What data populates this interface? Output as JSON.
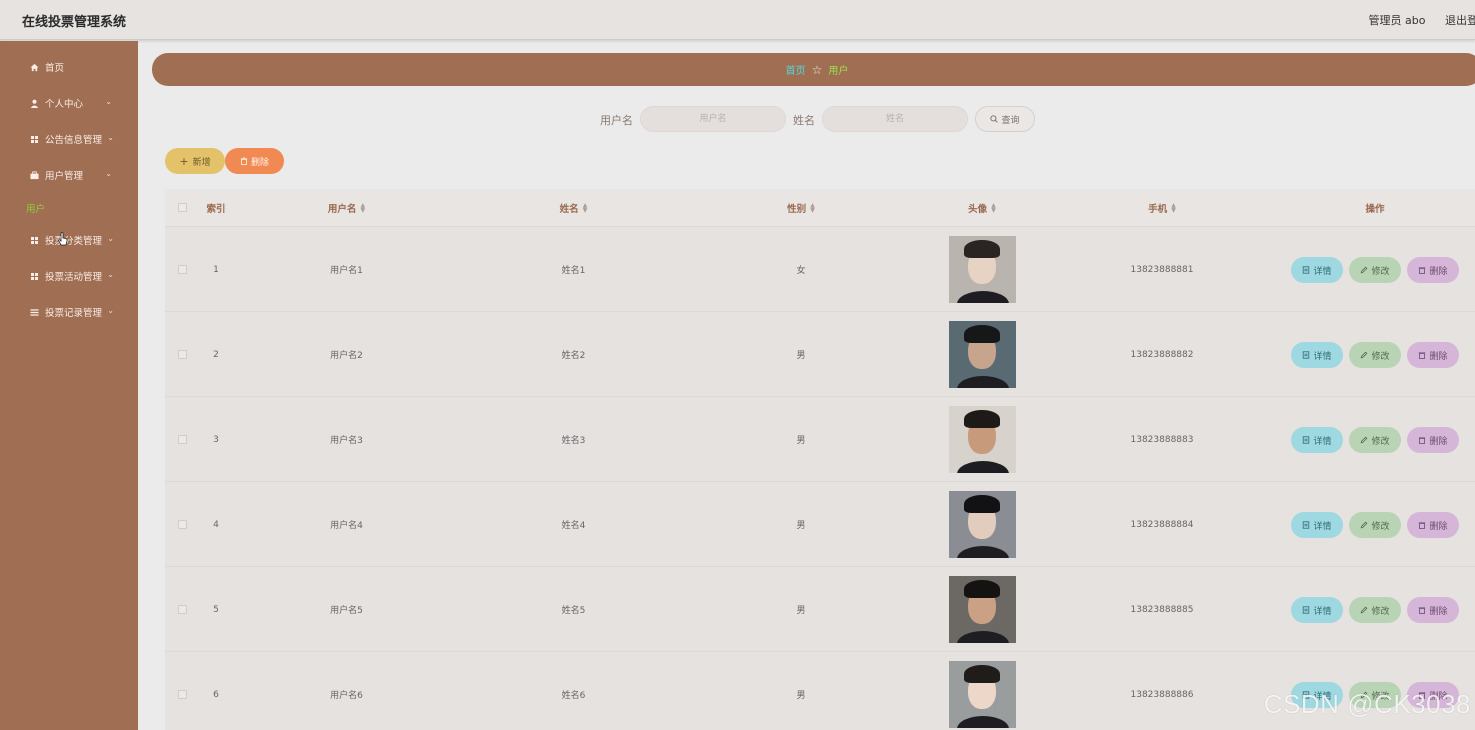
{
  "header": {
    "title": "在线投票管理系统",
    "user": "管理员 abo",
    "logout": "退出登录"
  },
  "sidebar": {
    "items": [
      {
        "label": "首页",
        "icon": "home-icon"
      },
      {
        "label": "个人中心",
        "icon": "user-icon"
      },
      {
        "label": "公告信息管理",
        "icon": "grid-icon"
      },
      {
        "label": "用户管理",
        "icon": "briefcase-icon"
      },
      {
        "label": "投票分类管理",
        "icon": "grid-icon"
      },
      {
        "label": "投票活动管理",
        "icon": "grid-icon"
      },
      {
        "label": "投票记录管理",
        "icon": "list-icon"
      }
    ],
    "active_sub": "用户"
  },
  "breadcrumb": {
    "home": "首页",
    "current": "用户"
  },
  "search": {
    "username_label": "用户名",
    "username_placeholder": "用户名",
    "name_label": "姓名",
    "name_placeholder": "姓名",
    "query_label": "查询"
  },
  "actions": {
    "add_label": "新增",
    "delete_label": "删除"
  },
  "table": {
    "headers": {
      "index": "索引",
      "username": "用户名",
      "name": "姓名",
      "gender": "性别",
      "avatar": "头像",
      "phone": "手机",
      "operation": "操作"
    },
    "row_actions": {
      "detail": "详情",
      "edit": "修改",
      "remove": "删除"
    },
    "rows": [
      {
        "index": "1",
        "username": "用户名1",
        "name": "姓名1",
        "gender": "女",
        "phone": "13823888881"
      },
      {
        "index": "2",
        "username": "用户名2",
        "name": "姓名2",
        "gender": "男",
        "phone": "13823888882"
      },
      {
        "index": "3",
        "username": "用户名3",
        "name": "姓名3",
        "gender": "男",
        "phone": "13823888883"
      },
      {
        "index": "4",
        "username": "用户名4",
        "name": "姓名4",
        "gender": "男",
        "phone": "13823888884"
      },
      {
        "index": "5",
        "username": "用户名5",
        "name": "姓名5",
        "gender": "男",
        "phone": "13823888885"
      },
      {
        "index": "6",
        "username": "用户名6",
        "name": "姓名6",
        "gender": "男",
        "phone": "13823888886"
      }
    ]
  },
  "watermark": "CSDN @CK3038",
  "colors": {
    "sidebar": "#9f6e53",
    "breadcrumb": "#a06f53",
    "add_button": "#e4c26a",
    "delete_button": "#f08a52",
    "detail_button": "#9ed8e0",
    "edit_button": "#b8d4b5",
    "remove_button": "#d5b6d8"
  }
}
